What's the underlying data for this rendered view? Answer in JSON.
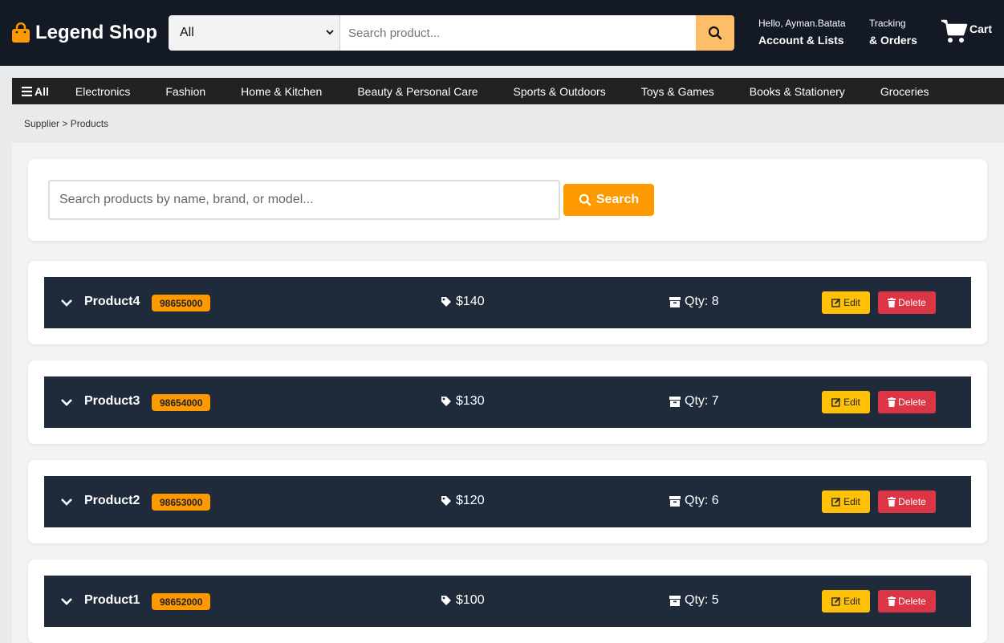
{
  "header": {
    "logo_text": "Legend Shop",
    "category_selected": "All",
    "search_placeholder": "Search product...",
    "account_greeting": "Hello, Ayman.Batata",
    "account_label": "Account & Lists",
    "tracking_small": "Tracking",
    "tracking_label": "& Orders",
    "cart_label": "Cart"
  },
  "nav": {
    "all_label": "All",
    "items": [
      "Electronics",
      "Fashion",
      "Home & Kitchen",
      "Beauty & Personal Care",
      "Sports & Outdoors",
      "Toys & Games",
      "Books & Stationery",
      "Groceries"
    ]
  },
  "breadcrumb": "Supplier > Products",
  "product_search": {
    "placeholder": "Search products by name, brand, or model...",
    "button_label": "Search"
  },
  "products": [
    {
      "name": "Product4",
      "sku": "98655000",
      "price": "$140",
      "qty": "Qty: 8"
    },
    {
      "name": "Product3",
      "sku": "98654000",
      "price": "$130",
      "qty": "Qty: 7"
    },
    {
      "name": "Product2",
      "sku": "98653000",
      "price": "$120",
      "qty": "Qty: 6"
    },
    {
      "name": "Product1",
      "sku": "98652000",
      "price": "$100",
      "qty": "Qty: 5"
    }
  ],
  "actions": {
    "edit_label": "Edit",
    "delete_label": "Delete"
  },
  "colors": {
    "header_bg": "#131a25",
    "accent_orange": "#ff9900",
    "search_button": "#febd69",
    "product_bar": "#1f2a3a",
    "edit": "#ffc107",
    "delete": "#dc3545"
  },
  "icons": {
    "logo": "shopping-bag-icon",
    "search": "search-icon",
    "cart": "cart-icon",
    "menu": "hamburger-icon",
    "expand": "chevron-down-icon",
    "price": "tag-icon",
    "qty": "box-icon",
    "edit": "edit-icon",
    "delete": "trash-icon"
  }
}
